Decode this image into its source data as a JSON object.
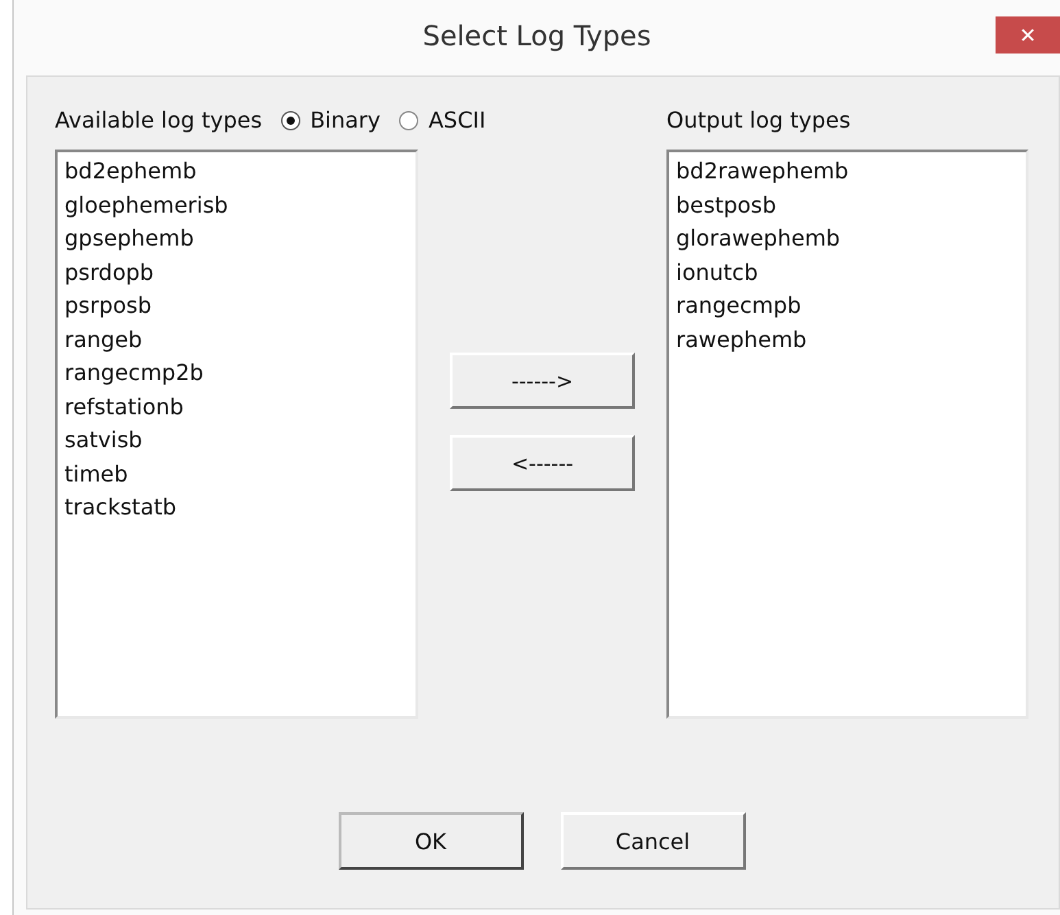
{
  "window": {
    "title": "Select Log Types",
    "close": "✕"
  },
  "available": {
    "label": "Available log types",
    "items": [
      "bd2ephemb",
      "gloephemerisb",
      "gpsephemb",
      "psrdopb",
      "psrposb",
      "rangeb",
      "rangecmp2b",
      "refstationb",
      "satvisb",
      "timeb",
      "trackstatb"
    ]
  },
  "format_options": [
    {
      "label": "Binary",
      "selected": true
    },
    {
      "label": "ASCII",
      "selected": false
    }
  ],
  "move_buttons": [
    "------>",
    "<------"
  ],
  "output": {
    "label": "Output log types",
    "items": [
      "bd2rawephemb",
      "bestposb",
      "glorawephemb",
      "ionutcb",
      "rangecmpb",
      "rawephemb"
    ]
  },
  "buttons": [
    "OK",
    "Cancel"
  ]
}
